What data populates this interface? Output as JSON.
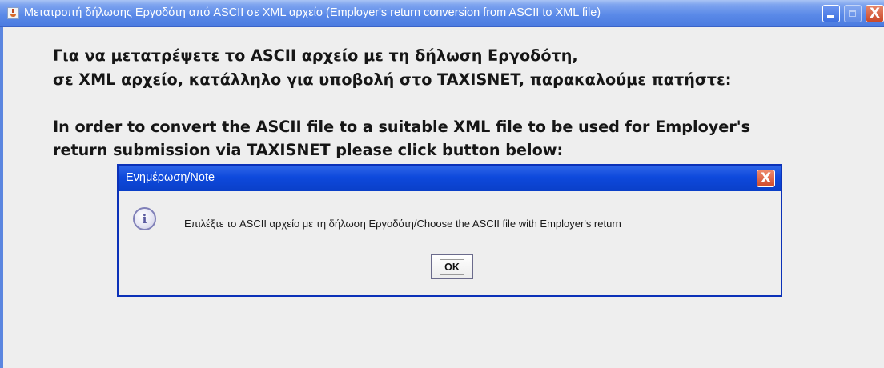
{
  "window": {
    "title": "Μετατροπή δήλωσης Εργοδότη από ASCII σε XML αρχείο (Employer's return conversion from ASCII to XML file)",
    "icons": {
      "app": "java-cup-icon",
      "minimize": "minimize-icon",
      "maximize": "maximize-icon",
      "close": "close-icon"
    },
    "close_glyph": "X"
  },
  "instructions": {
    "greek_line1": "Για να μετατρέψετε το ASCII αρχείο με τη δήλωση Εργοδότη,",
    "greek_line2": "σε XML αρχείο, κατάλληλο για υποβολή στο TAXISNET, παρακαλούμε πατήστε:",
    "english_line1": "In order to convert the ASCII file to a suitable XML file to be used for Employer's",
    "english_line2": "return submission via TAXISNET please click button below:"
  },
  "dialog": {
    "title": "Ενημέρωση/Note",
    "icon": "info-icon",
    "icon_glyph": "i",
    "message": "Επιλέξτε το ASCII αρχείο με τη δήλωση Εργοδότη/Choose the ASCII file with Employer's return",
    "ok_label": "OK",
    "close_glyph": "X"
  },
  "colors": {
    "titlebar": "#5b8ae8",
    "dialog_titlebar": "#0e49dc",
    "close_button": "#d04a2c",
    "background": "#eeeeee"
  }
}
